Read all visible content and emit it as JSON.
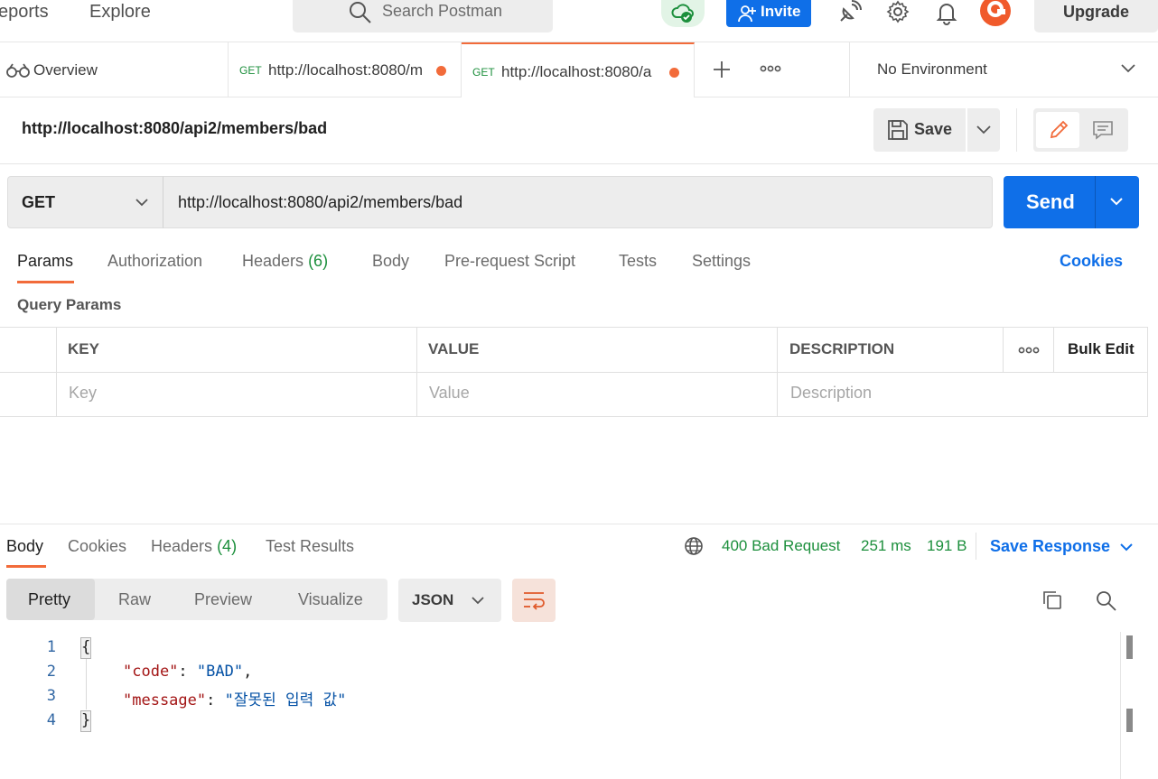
{
  "header": {
    "nav": [
      "eports",
      "Explore"
    ],
    "search_placeholder": "Search Postman",
    "invite_label": "Invite",
    "upgrade_label": "Upgrade",
    "icons": [
      "cloud-sync-icon",
      "satellite-icon",
      "settings-gear-icon",
      "bell-icon",
      "avatar-icon"
    ]
  },
  "tabs": {
    "overview_label": "Overview",
    "items": [
      {
        "method": "GET",
        "url": "http://localhost:8080/m",
        "unsaved": true
      },
      {
        "method": "GET",
        "url": "http://localhost:8080/a",
        "unsaved": true,
        "active": true
      }
    ],
    "environment": "No Environment"
  },
  "request": {
    "title": "http://localhost:8080/api2/members/bad",
    "save_label": "Save",
    "method": "GET",
    "url": "http://localhost:8080/api2/members/bad",
    "send_label": "Send"
  },
  "request_tabs": {
    "params": "Params",
    "authorization": "Authorization",
    "headers": "Headers",
    "headers_count": "(6)",
    "body": "Body",
    "prerequest": "Pre-request Script",
    "tests": "Tests",
    "settings": "Settings",
    "cookies": "Cookies"
  },
  "query_params": {
    "title": "Query Params",
    "columns": [
      "KEY",
      "VALUE",
      "DESCRIPTION"
    ],
    "bulk_edit": "Bulk Edit",
    "placeholders": {
      "key": "Key",
      "value": "Value",
      "description": "Description"
    }
  },
  "response": {
    "tabs": {
      "body": "Body",
      "cookies": "Cookies",
      "headers": "Headers",
      "headers_count": "(4)",
      "test_results": "Test Results"
    },
    "status": "400 Bad Request",
    "time": "251 ms",
    "size": "191 B",
    "save_response": "Save Response",
    "views": [
      "Pretty",
      "Raw",
      "Preview",
      "Visualize"
    ],
    "format": "JSON",
    "body_lines": [
      {
        "n": "1",
        "text": "{"
      },
      {
        "n": "2",
        "key": "\"code\"",
        "value": "\"BAD\"",
        "trail": ","
      },
      {
        "n": "3",
        "key": "\"message\"",
        "value": "\"잘못된 입력 값\"",
        "trail": ""
      },
      {
        "n": "4",
        "text": "}"
      }
    ]
  },
  "colors": {
    "accent": "#f26b3a",
    "primary": "#0f6fe8",
    "success": "#1c8f3c"
  }
}
